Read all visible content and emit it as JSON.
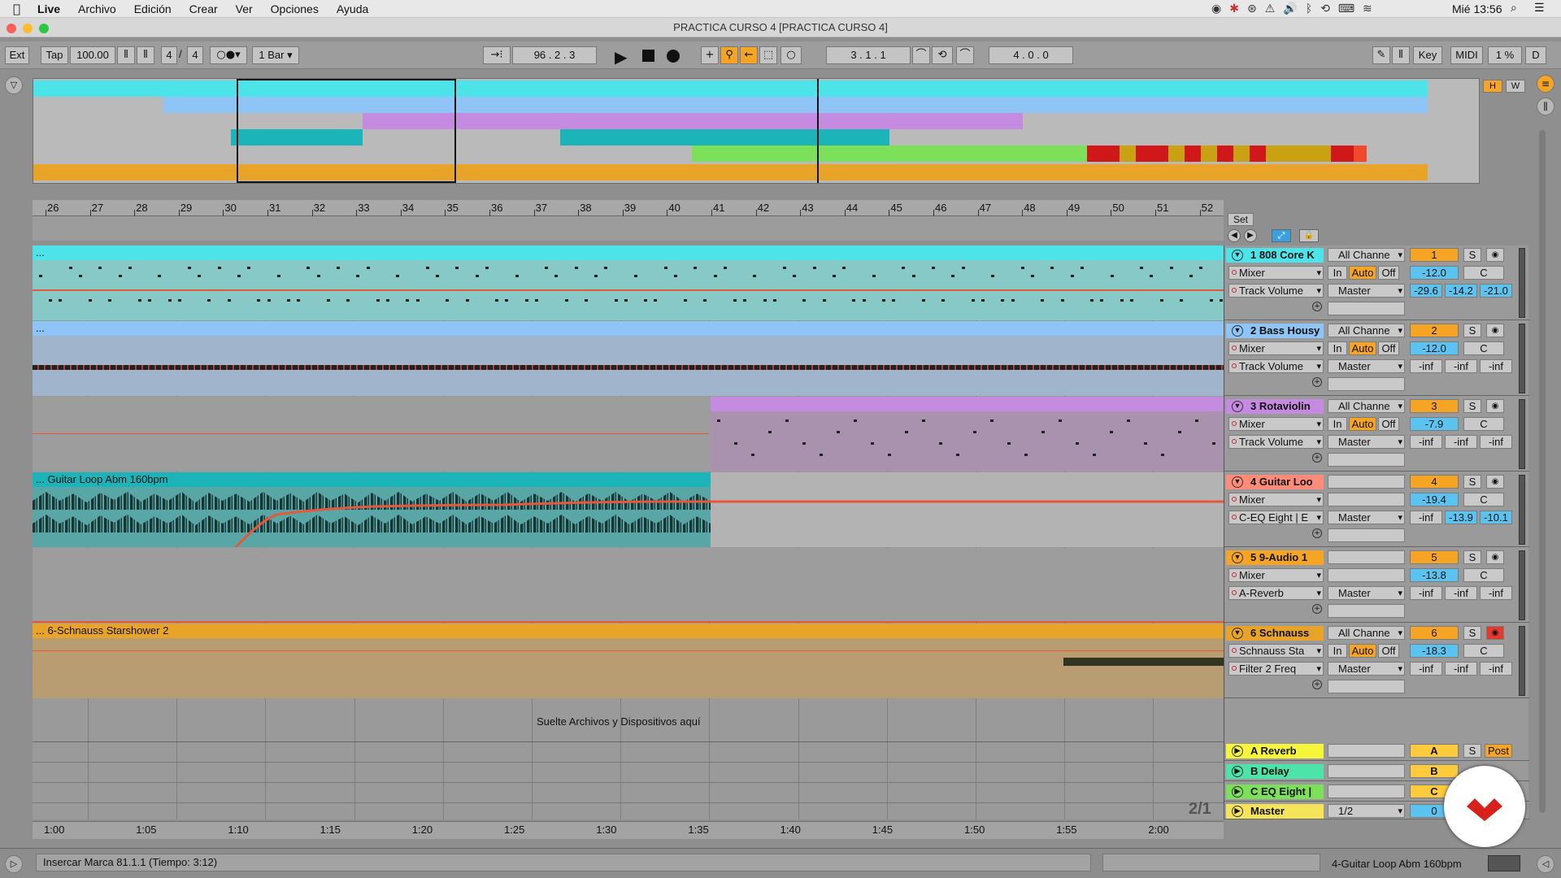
{
  "menubar": {
    "items": [
      "Live",
      "Archivo",
      "Edición",
      "Crear",
      "Ver",
      "Opciones",
      "Ayuda"
    ],
    "clock": "Mié 13:56"
  },
  "window": {
    "title": "PRACTICA CURSO 4  [PRACTICA CURSO 4]"
  },
  "control": {
    "ext": "Ext",
    "tap": "Tap",
    "tempo": "100.00",
    "signature_num": "4",
    "signature_den": "4",
    "quantize": "1 Bar",
    "arrangement_pos": "96 .  2 .  3",
    "loop_start": "3 .  1 .  1",
    "loop_length": "4 .  0 .  0",
    "key": "Key",
    "midi": "MIDI",
    "cpu": "1 %",
    "d": "D"
  },
  "overview": {
    "h_label": "H",
    "w_label": "W"
  },
  "ruler": {
    "bars": [
      "26",
      "27",
      "28",
      "29",
      "30",
      "31",
      "32",
      "33",
      "34",
      "35",
      "36",
      "37",
      "38",
      "39",
      "40",
      "41",
      "42",
      "43",
      "44",
      "45",
      "46",
      "47",
      "48",
      "49",
      "50",
      "51",
      "52"
    ],
    "set_label": "Set"
  },
  "tracks": [
    {
      "number": "1",
      "name": "808 Core K",
      "color": "#4ce4e8",
      "input": "All Channe",
      "device": "Mixer",
      "param": "Track Volume",
      "output": "Master",
      "in": "In",
      "auto": "Auto",
      "off": "Off",
      "track_num": "1",
      "solo": "S",
      "vol": "-12.0",
      "pan": "C",
      "v1": "-29.6",
      "v2": "-14.2",
      "v3": "-21.0",
      "clip": "..."
    },
    {
      "number": "2",
      "name": "Bass Housy",
      "color": "#8ec4f6",
      "input": "All Channe",
      "device": "Mixer",
      "param": "Track Volume",
      "output": "Master",
      "in": "In",
      "auto": "Auto",
      "off": "Off",
      "track_num": "2",
      "solo": "S",
      "vol": "-12.0",
      "pan": "C",
      "v1": "-inf",
      "v2": "-inf",
      "v3": "-inf",
      "clip": "..."
    },
    {
      "number": "3",
      "name": "Rotaviolin",
      "color": "#c58be0",
      "input": "All Channe",
      "device": "Mixer",
      "param": "Track Volume",
      "output": "Master",
      "in": "In",
      "auto": "Auto",
      "off": "Off",
      "track_num": "3",
      "solo": "S",
      "vol": "-7.9",
      "pan": "C",
      "v1": "-inf",
      "v2": "-inf",
      "v3": "-inf",
      "clip": ""
    },
    {
      "number": "4",
      "name": "Guitar Loo",
      "color": "#ff8c78",
      "input": "",
      "device": "Mixer",
      "param": "C-EQ Eight | E",
      "output": "Master",
      "track_num": "4",
      "solo": "S",
      "vol": "-19.4",
      "pan": "C",
      "v1": "-inf",
      "v2": "-13.9",
      "v3": "-10.1",
      "clip": "... Guitar Loop Abm 160bpm"
    },
    {
      "number": "5",
      "name": "9-Audio 1",
      "color": "#f6a423",
      "input": "",
      "device": "Mixer",
      "param": "A-Reverb",
      "output": "Master",
      "track_num": "5",
      "solo": "S",
      "vol": "-13.8",
      "pan": "C",
      "v1": "-inf",
      "v2": "-inf",
      "v3": "-inf",
      "clip": ""
    },
    {
      "number": "6",
      "name": "Schnauss",
      "color": "#e8a428",
      "input": "All Channe",
      "device": "Schnauss Sta",
      "param": "Filter 2 Freq",
      "output": "Master",
      "in": "In",
      "auto": "Auto",
      "off": "Off",
      "track_num": "6",
      "solo": "S",
      "vol": "-18.3",
      "pan": "C",
      "v1": "-inf",
      "v2": "-inf",
      "v3": "-inf",
      "clip": "... 6-Schnauss Starshower 2"
    }
  ],
  "drop_text": "Suelte Archivos y Dispositivos aquí",
  "returns": [
    {
      "name": "A Reverb",
      "letter": "A",
      "solo": "S",
      "post": "Post"
    },
    {
      "name": "B Delay",
      "letter": "B"
    },
    {
      "name": "C EQ Eight |",
      "letter": "C"
    }
  ],
  "master": {
    "name": "Master",
    "output": "1/2",
    "num": "0"
  },
  "zoom_label": "2/1",
  "time_ruler": [
    "1:00",
    "1:05",
    "1:10",
    "1:15",
    "1:20",
    "1:25",
    "1:30",
    "1:35",
    "1:40",
    "1:45",
    "1:50",
    "1:55",
    "2:00"
  ],
  "status": {
    "message": "Insercar Marca 81.1.1 (Tiempo: 3:12)",
    "clip_name": "4-Guitar Loop Abm 160bpm"
  },
  "colors": {
    "accent": "#f6a423",
    "blue": "#5bc3f0",
    "record_red": "#e33a2b"
  }
}
